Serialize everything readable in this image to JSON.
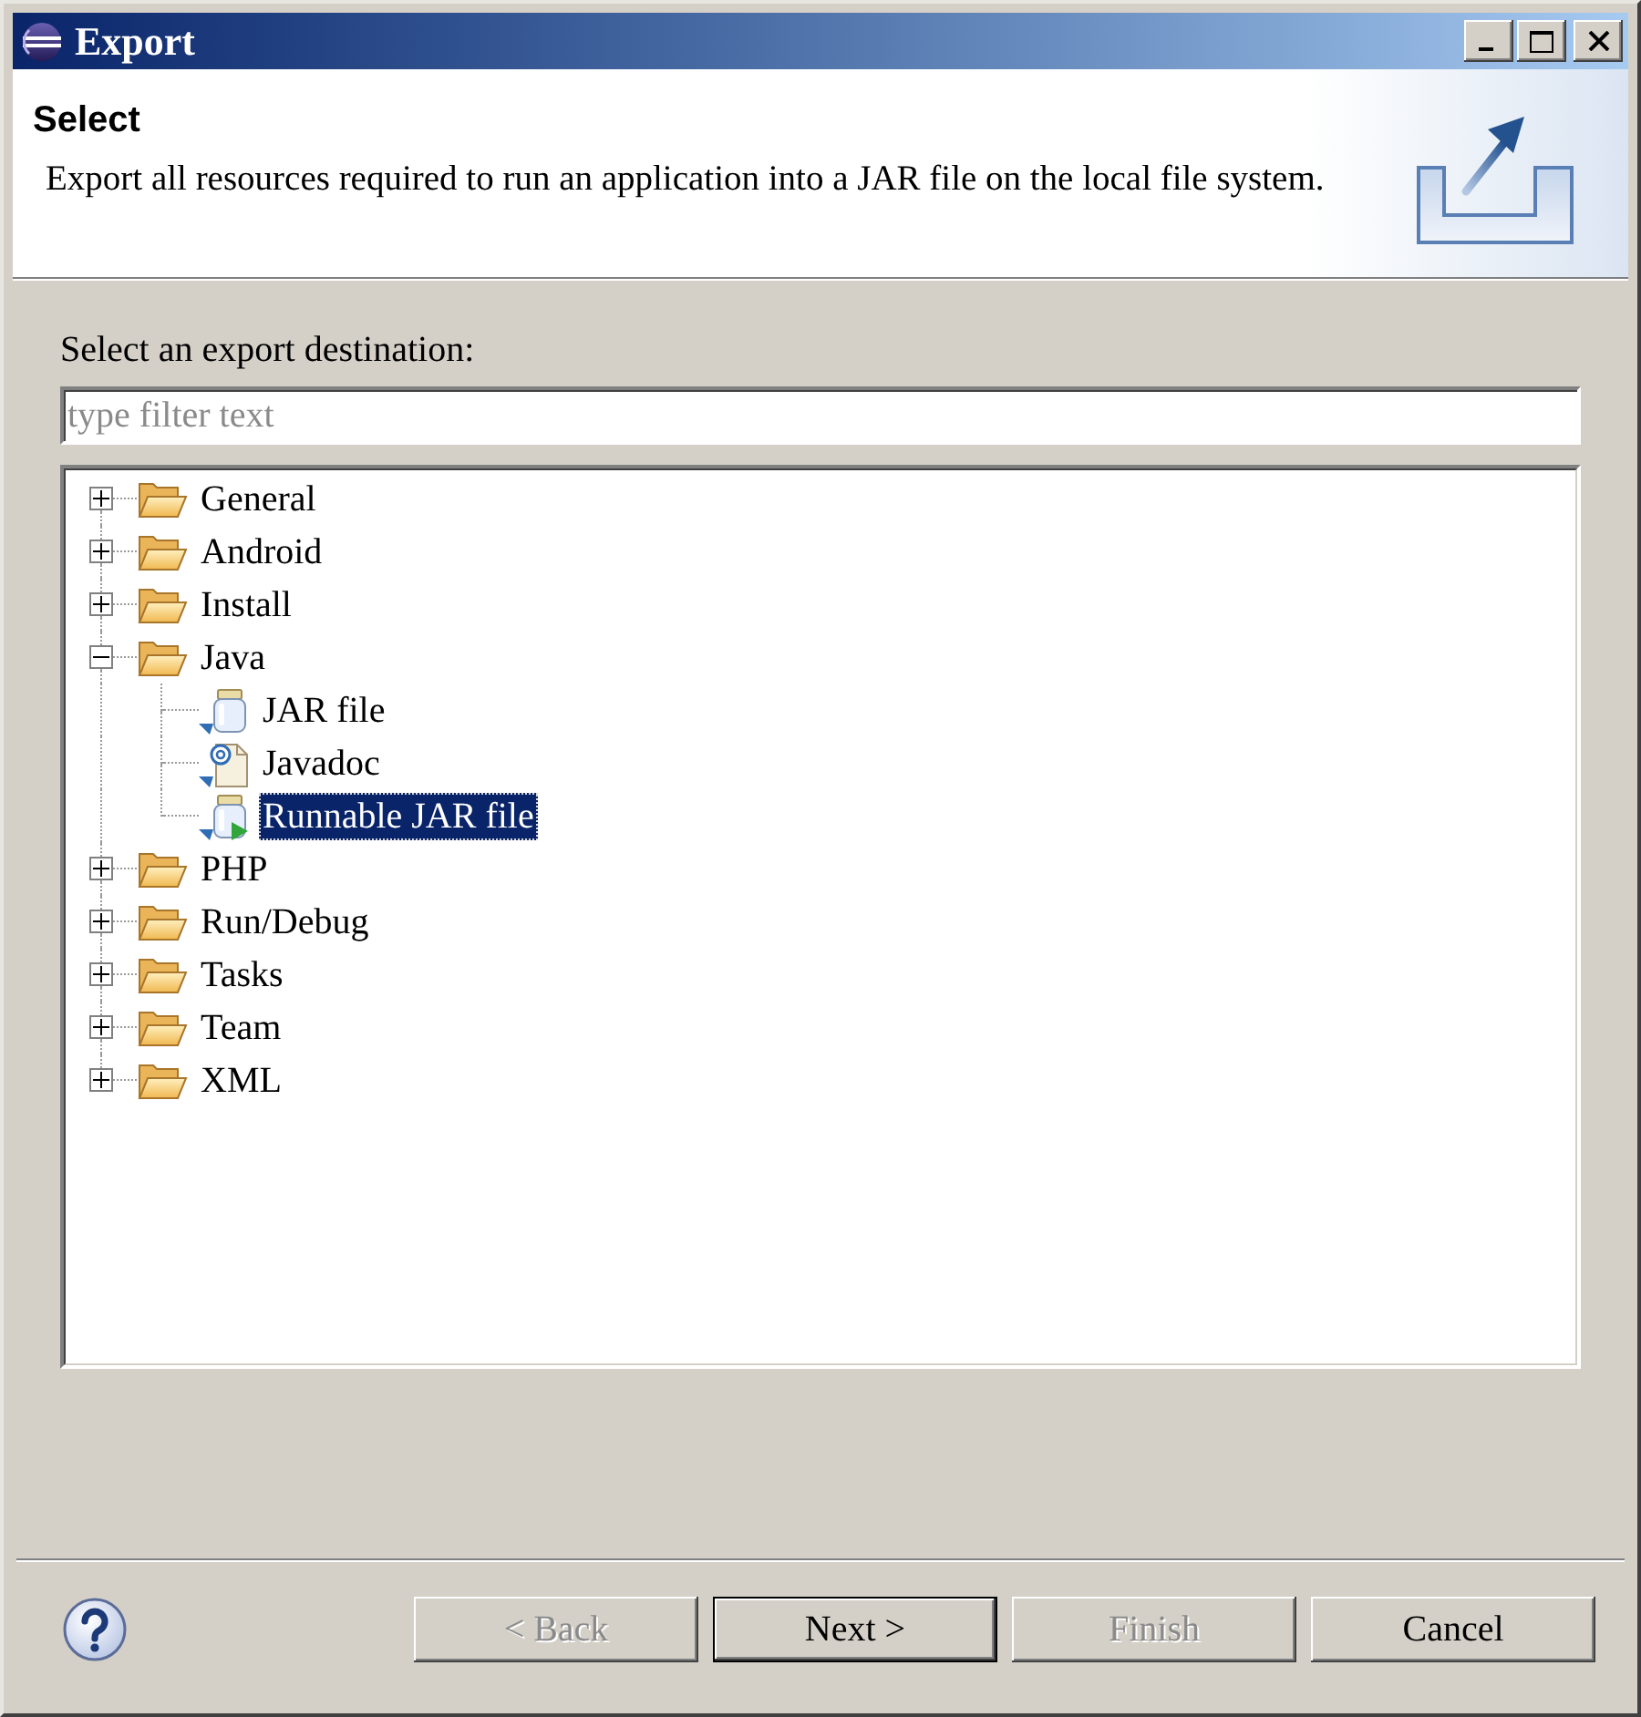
{
  "window": {
    "title": "Export"
  },
  "header": {
    "title": "Select",
    "description": "Export all resources required to run an application into a JAR file on the local file system."
  },
  "filter": {
    "label": "Select an export destination:",
    "placeholder": "type filter text"
  },
  "tree": [
    {
      "label": "General",
      "kind": "folder",
      "expanded": false,
      "selected": false
    },
    {
      "label": "Android",
      "kind": "folder",
      "expanded": false,
      "selected": false
    },
    {
      "label": "Install",
      "kind": "folder",
      "expanded": false,
      "selected": false
    },
    {
      "label": "Java",
      "kind": "folder",
      "expanded": true,
      "selected": false,
      "children": [
        {
          "label": "JAR file",
          "kind": "jar",
          "selected": false
        },
        {
          "label": "Javadoc",
          "kind": "javadoc",
          "selected": false
        },
        {
          "label": "Runnable JAR file",
          "kind": "runnable_jar",
          "selected": true
        }
      ]
    },
    {
      "label": "PHP",
      "kind": "folder",
      "expanded": false,
      "selected": false
    },
    {
      "label": "Run/Debug",
      "kind": "folder",
      "expanded": false,
      "selected": false
    },
    {
      "label": "Tasks",
      "kind": "folder",
      "expanded": false,
      "selected": false
    },
    {
      "label": "Team",
      "kind": "folder",
      "expanded": false,
      "selected": false
    },
    {
      "label": "XML",
      "kind": "folder",
      "expanded": false,
      "selected": false
    }
  ],
  "buttons": [
    {
      "label": "< Back",
      "disabled": true,
      "default": false
    },
    {
      "label": "Next >",
      "disabled": false,
      "default": true
    },
    {
      "label": "Finish",
      "disabled": true,
      "default": false
    },
    {
      "label": "Cancel",
      "disabled": false,
      "default": false
    }
  ]
}
